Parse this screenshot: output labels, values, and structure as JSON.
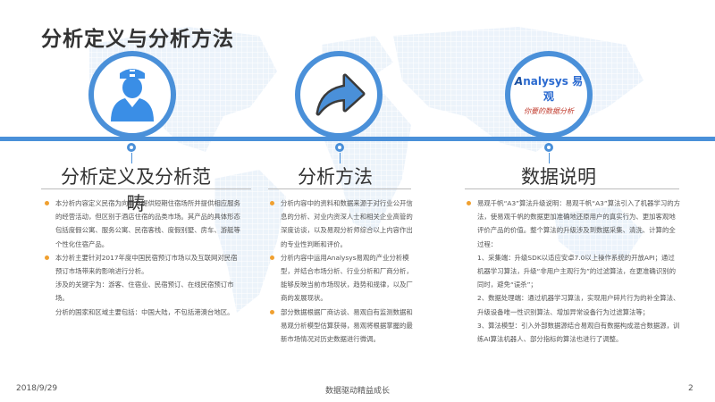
{
  "title": "分析定义与分析方法",
  "icons": {
    "col1": "nurse-icon",
    "col2": "arrow-icon",
    "col3": "analysys-logo"
  },
  "logo": {
    "brand": "nalysys",
    "brand_cn": "易观",
    "slogan": "你要的数据分析"
  },
  "watermark": "易观",
  "columns": [
    {
      "title": "分析定义及分析范畴",
      "paragraphs": [
        {
          "bullet": true,
          "text": "本分析内容定义民宿为向用户提供短期住宿场所并提供相应服务的经营活动，但区别于酒店住宿的品类市场。其产品的具体形态包括度假公寓、服务公寓、民宿客栈、度假别墅、房车、游艇等个性化住宿产品。"
        },
        {
          "bullet": true,
          "text": "本分析主要针对2017年度中国民宿预订市场以及互联网对民宿预订市场带来的影响进行分析。"
        },
        {
          "bullet": false,
          "text": "涉及的关键字为：游客、住宿业、民宿预订、在线民宿预订市场。"
        },
        {
          "bullet": false,
          "text": "分析的国家和区域主要包括：中国大陆，不包括港澳台地区。"
        }
      ]
    },
    {
      "title": "分析方法",
      "paragraphs": [
        {
          "bullet": true,
          "text": "分析内容中的资料和数据来源于对行业公开信息的分析、对业内资深人士和相关企业高管的深度访谈，以及易观分析师综合以上内容作出的专业性判断和评价。"
        },
        {
          "bullet": true,
          "text": "分析内容中运用Analysys易观的产业分析模型，并结合市场分析、行业分析和厂商分析，能够反映当前市场现状，趋势和规律，以及厂商的发展现状。"
        },
        {
          "bullet": true,
          "text": "部分数据根据厂商访谈、易观自有监测数据和易观分析模型估算获得，易观将根据掌握的最新市场情况对历史数据进行微调。"
        }
      ]
    },
    {
      "title": "数据说明",
      "paragraphs": [
        {
          "bullet": true,
          "text": "易观千帆“A3”算法升级说明：易观千帆“A3”算法引入了机器学习的方法，使易观千帆的数据更加准确地还原用户的真实行为、更加客观地评价产品的价值。整个算法的升级涉及到数据采集、清洗、计算的全过程："
        },
        {
          "bullet": false,
          "text": "1、采集端：升级SDK以适应安卓7.0以上操作系统的开放API；通过机器学习算法，升级“非用户主观行为”的过滤算法，在更准确识别的 同时，避免“误杀”；"
        },
        {
          "bullet": false,
          "text": "2、数据处理端：通过机器学习算法，实现用户碎片行为的补全算法、升级设备唯一性识别算法、增加异常设备行为过滤算法等；"
        },
        {
          "bullet": false,
          "text": "3、算法模型：引入外部数据源结合易观自有数据构成混合数据源，训练AI算法机器人、部分指标的算法也进行了调整。"
        }
      ]
    }
  ],
  "footer": {
    "date": "2018/9/29",
    "slogan": "数据驱动精益成长",
    "page": "2"
  }
}
